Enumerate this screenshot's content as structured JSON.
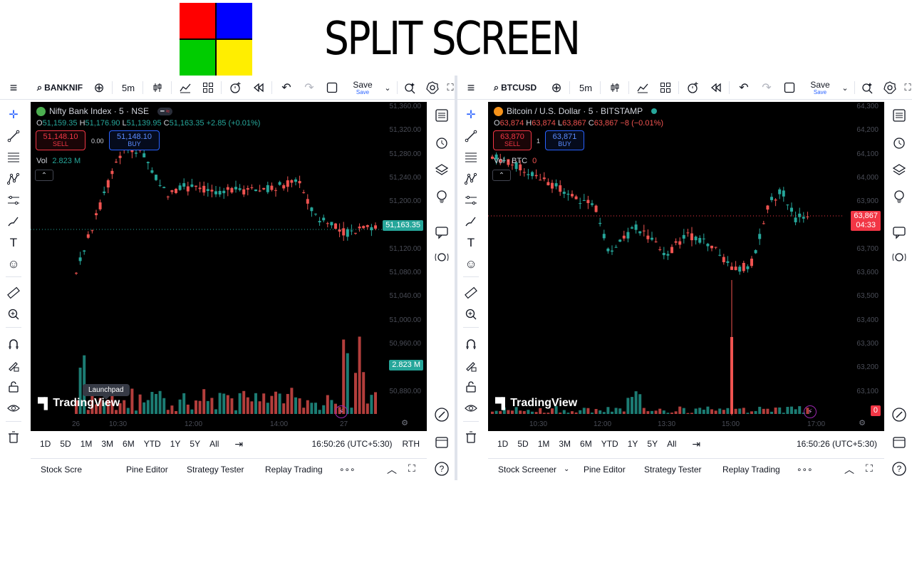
{
  "banner": {
    "title": "SPLIT SCREEN",
    "logo_colors": [
      "#ff0000",
      "#0000ff",
      "#00cc00",
      "#ffee00"
    ]
  },
  "colors": {
    "up": "#26a69a",
    "down": "#ef5350",
    "chart_bg": "#000000",
    "accent": "#2962ff"
  },
  "left": {
    "toolbar": {
      "symbol": "BANKNIF",
      "interval": "5m",
      "save_label": "Save",
      "save_sub": "Save"
    },
    "legend": {
      "title": "Nifty Bank Index · 5 · NSE",
      "o": "51,159.35",
      "h": "51,176.90",
      "l": "51,139.95",
      "c": "51,163.35",
      "change": "+2.85 (+0.01%)",
      "sell_price": "51,148.10",
      "sell_label": "SELL",
      "spread": "0.00",
      "buy_price": "51,148.10",
      "buy_label": "BUY",
      "vol_label": "Vol",
      "vol_value": "2.823 M"
    },
    "price_axis": [
      "51,360.00",
      "51,320.00",
      "51,280.00",
      "51,240.00",
      "51,200.00",
      "51,160.00",
      "51,120.00",
      "51,080.00",
      "51,040.00",
      "51,000.00",
      "50,960.00",
      "50,920.00",
      "50,880.00"
    ],
    "last_price": "51,163.35",
    "vol_tag": "2.823 M",
    "time_axis": [
      "26",
      "10:30",
      "12:00",
      "14:00",
      "27"
    ],
    "bottom": {
      "timeframes": [
        "1D",
        "5D",
        "1M",
        "3M",
        "6M",
        "YTD",
        "1Y",
        "5Y",
        "All"
      ],
      "clock": "16:50:26 (UTC+5:30)",
      "session": "RTH"
    },
    "tabs": [
      "Stock Scre",
      "Pine Editor",
      "Strategy Tester",
      "Replay Trading"
    ],
    "tooltip": "Launchpad"
  },
  "right": {
    "toolbar": {
      "symbol": "BTCUSD",
      "interval": "5m",
      "save_label": "Save",
      "save_sub": "Save"
    },
    "legend": {
      "title": "Bitcoin / U.S. Dollar · 5 · BITSTAMP",
      "o": "63,874",
      "h": "63,874",
      "l": "63,867",
      "c": "63,867",
      "change": "−8 (−0.01%)",
      "sell_price": "63,870",
      "sell_label": "SELL",
      "spread": "1",
      "buy_price": "63,871",
      "buy_label": "BUY",
      "vol_label": "Vol · BTC",
      "vol_value": "0"
    },
    "price_axis": [
      "64,300",
      "64,200",
      "64,100",
      "64,000",
      "63,900",
      "63,800",
      "63,700",
      "63,600",
      "63,500",
      "63,400",
      "63,300",
      "63,200",
      "63,100"
    ],
    "last_price": "63,867",
    "countdown": "04:33",
    "vol_tag": "0",
    "time_axis": [
      "10:30",
      "12:00",
      "13:30",
      "15:00",
      "17:00"
    ],
    "bottom": {
      "timeframes": [
        "1D",
        "5D",
        "1M",
        "3M",
        "6M",
        "YTD",
        "1Y",
        "5Y",
        "All"
      ],
      "clock": "16:50:26 (UTC+5:30)"
    },
    "tabs": [
      "Stock Screener",
      "Pine Editor",
      "Strategy Tester",
      "Replay Trading"
    ]
  },
  "brand": "TradingView"
}
